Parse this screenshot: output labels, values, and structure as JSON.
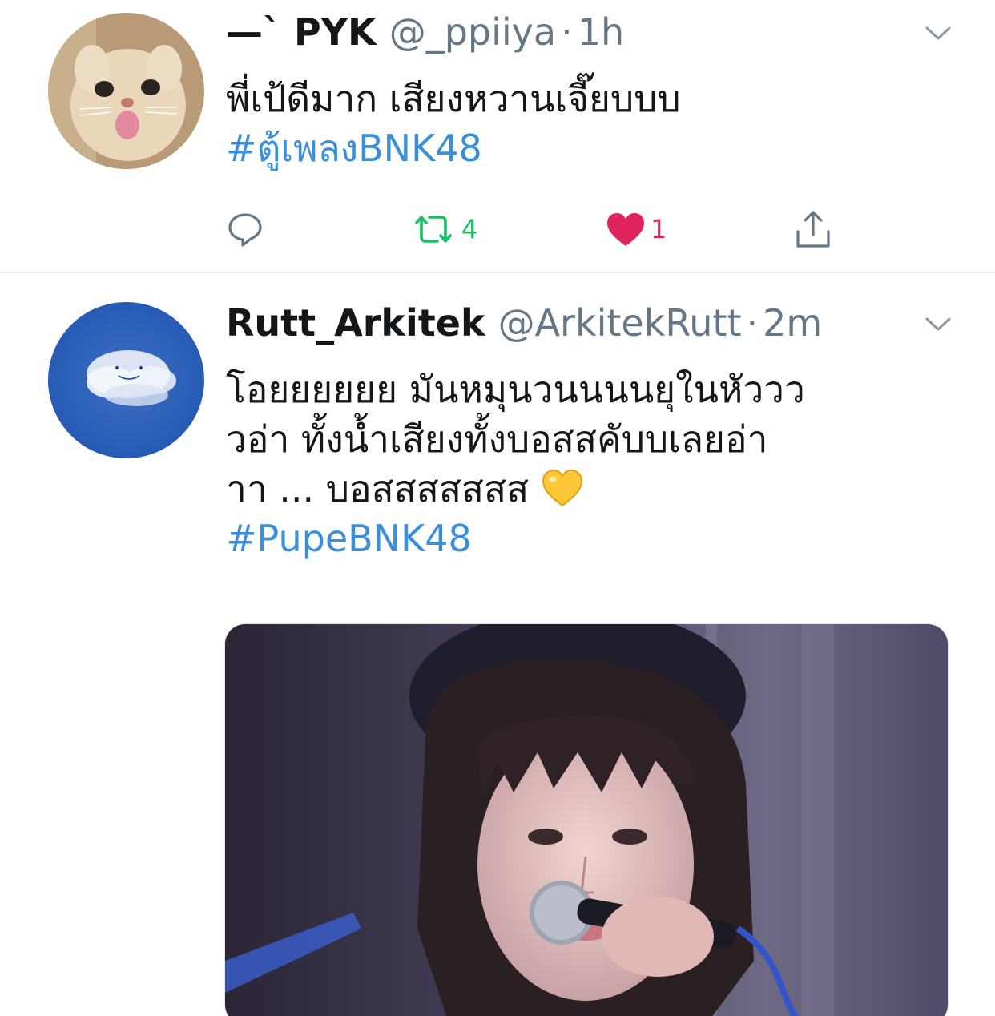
{
  "tweets": [
    {
      "display_name": "—` PYK",
      "handle": "@_ppiiya",
      "separator": "·",
      "time": "1h",
      "text_lines": [
        "พี่เป้ดีมาก เสียงหวานเจี๊ยบบบ"
      ],
      "hashtag": "#ตู้เพลงBNK48",
      "avatar": "cat-avatar",
      "actions": {
        "reply_icon": "reply-icon",
        "retweet_icon": "retweet-icon",
        "retweet_count": "4",
        "like_icon": "heart-icon",
        "like_count": "1",
        "share_icon": "share-icon"
      },
      "retweeted": true,
      "liked": true
    },
    {
      "display_name": "Rutt_Arkitek",
      "handle": "@ArkitekRutt",
      "separator": "·",
      "time": "2m",
      "text_lines": [
        "โอยยยยยย มันหมุนวนนนนยุในหัววว",
        "วอ่า ทั้งน้ำเสียงทั้งบอสสคับบเลยอ่า",
        "าา ... บอสสสสสสส"
      ],
      "emoji": "yellow-heart-emoji",
      "hashtag": "#PupeBNK48",
      "avatar": "cloud-avatar",
      "media": "singer-photo"
    }
  ],
  "colors": {
    "link": "#3a8fd8",
    "retweet_green": "#17bf63",
    "like_red": "#e0245e",
    "secondary_text": "#657786",
    "divider": "#e6ecf0"
  }
}
